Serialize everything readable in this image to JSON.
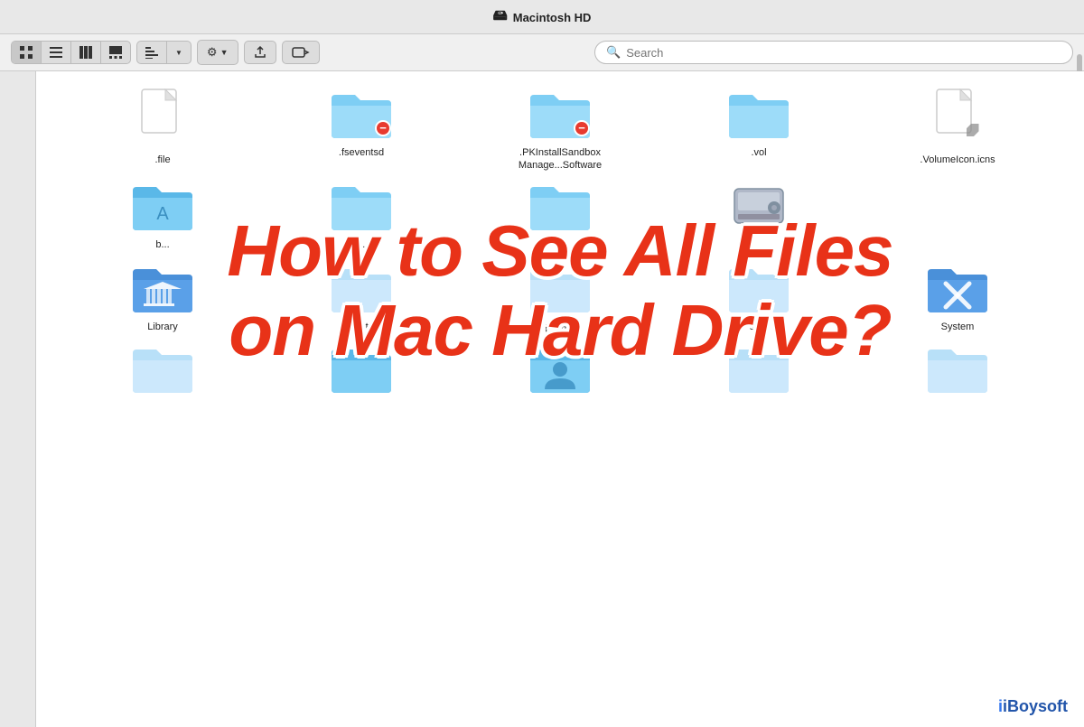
{
  "titleBar": {
    "title": "Macintosh HD",
    "hddIcon": "💾"
  },
  "toolbar": {
    "viewIcons": [
      "grid",
      "list",
      "columns",
      "gallery"
    ],
    "searchPlaceholder": "Search"
  },
  "overlayText": {
    "line1": "How to See All Files",
    "line2": "on Mac Hard Drive?"
  },
  "files": {
    "row1": [
      {
        "name": ".file",
        "type": "file"
      },
      {
        "name": ".fseventsd",
        "type": "folder-badge"
      },
      {
        "name": ".PKInstallSandbox\nManage...Software",
        "type": "folder-badge"
      },
      {
        "name": ".vol",
        "type": "folder"
      },
      {
        "name": ".VolumeIcon.icns",
        "type": "file-alias"
      }
    ],
    "row2": [
      {
        "name": "b...",
        "type": "folder-dark"
      },
      {
        "name": "c...",
        "type": "folder"
      },
      {
        "name": "e...",
        "type": "folder"
      },
      {
        "name": "",
        "type": "hdd"
      }
    ],
    "row3": [
      {
        "name": "Library",
        "type": "folder-library"
      },
      {
        "name": "opt",
        "type": "folder-light"
      },
      {
        "name": "private",
        "type": "folder-light"
      },
      {
        "name": "sbin",
        "type": "folder-light"
      },
      {
        "name": "System",
        "type": "folder-system"
      }
    ],
    "row4": [
      {
        "name": "",
        "type": "folder-light"
      },
      {
        "name": "",
        "type": "folder-dark"
      },
      {
        "name": "",
        "type": "folder-user"
      },
      {
        "name": "",
        "type": "folder-light"
      },
      {
        "name": "",
        "type": "folder-light"
      }
    ]
  },
  "watermark": "iBoysoft"
}
